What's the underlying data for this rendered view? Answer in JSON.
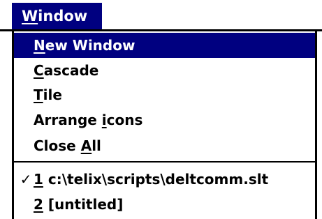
{
  "menubar": {
    "title": "Window",
    "title_mnemonic": "W"
  },
  "menu": {
    "items": [
      {
        "label": "New Window",
        "mnemonic": "N",
        "selected": true
      },
      {
        "label": "Cascade",
        "mnemonic": "C",
        "selected": false
      },
      {
        "label": "Tile",
        "mnemonic": "T",
        "selected": false
      },
      {
        "label": "Arrange icons",
        "mnemonic": "i",
        "selected": false
      },
      {
        "label": "Close All",
        "mnemonic": "A",
        "selected": false
      }
    ],
    "windows": [
      {
        "number": "1",
        "label": "c:\\telix\\scripts\\deltcomm.slt",
        "checked": true,
        "check_glyph": "✓"
      },
      {
        "number": "2",
        "label": "[untitled]",
        "checked": false,
        "check_glyph": ""
      }
    ]
  },
  "colors": {
    "highlight": "#000080",
    "highlight_text": "#ffffff",
    "text": "#000000",
    "background": "#ffffff"
  }
}
